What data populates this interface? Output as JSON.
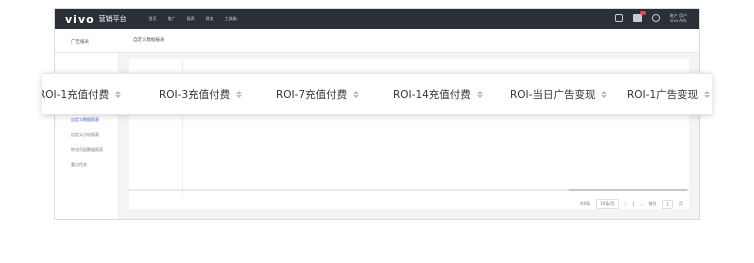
{
  "topbar": {
    "brand": "vivo",
    "brand_sub": "营销平台",
    "nav": [
      "首页",
      "推广",
      "报表",
      "财务",
      "工具箱"
    ],
    "user_line1": "账户 用户",
    "user_line2": "vivo Ads"
  },
  "subbar": {
    "side_title": "广告报表",
    "breadcrumb": "自定义数据报表"
  },
  "sidebar": {
    "items": [
      {
        "label": "自定义数据报表",
        "active": true
      },
      {
        "label": "自定义分析报表",
        "active": false
      },
      {
        "label": "转化归因数据报表",
        "active": false
      },
      {
        "label": "重点任务",
        "active": false
      }
    ]
  },
  "table": {
    "columns": [
      {
        "label": "ROI-1充值付费"
      },
      {
        "label": "ROI-3充值付费"
      },
      {
        "label": "ROI-7充值付费"
      },
      {
        "label": "ROI-14充值付费"
      },
      {
        "label": "ROI-当日广告变现"
      },
      {
        "label": "ROI-1广告变现"
      }
    ]
  },
  "pagination": {
    "total": "共0条",
    "page_size": "10条/页",
    "prev": "‹",
    "page": "1",
    "next": "›",
    "goto_label": "前往",
    "goto_value": "1",
    "page_suffix": "页"
  },
  "colors": {
    "topbar": "#2b2f38",
    "accent": "#4165d6"
  }
}
